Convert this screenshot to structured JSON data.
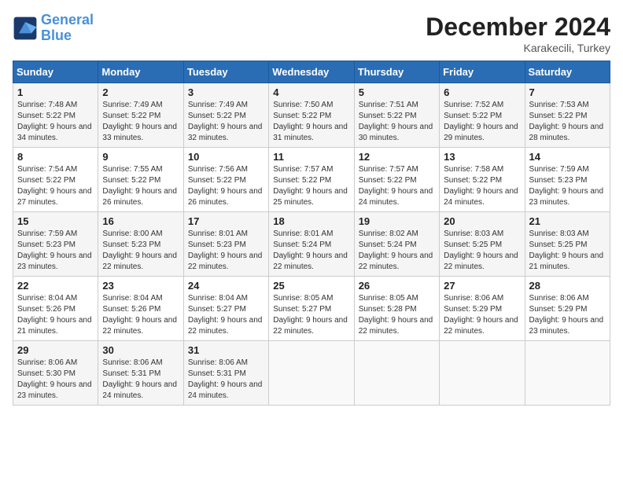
{
  "header": {
    "logo_line1": "General",
    "logo_line2": "Blue",
    "month": "December 2024",
    "location": "Karakecili, Turkey"
  },
  "weekdays": [
    "Sunday",
    "Monday",
    "Tuesday",
    "Wednesday",
    "Thursday",
    "Friday",
    "Saturday"
  ],
  "weeks": [
    [
      {
        "day": "1",
        "sunrise": "Sunrise: 7:48 AM",
        "sunset": "Sunset: 5:22 PM",
        "daylight": "Daylight: 9 hours and 34 minutes."
      },
      {
        "day": "2",
        "sunrise": "Sunrise: 7:49 AM",
        "sunset": "Sunset: 5:22 PM",
        "daylight": "Daylight: 9 hours and 33 minutes."
      },
      {
        "day": "3",
        "sunrise": "Sunrise: 7:49 AM",
        "sunset": "Sunset: 5:22 PM",
        "daylight": "Daylight: 9 hours and 32 minutes."
      },
      {
        "day": "4",
        "sunrise": "Sunrise: 7:50 AM",
        "sunset": "Sunset: 5:22 PM",
        "daylight": "Daylight: 9 hours and 31 minutes."
      },
      {
        "day": "5",
        "sunrise": "Sunrise: 7:51 AM",
        "sunset": "Sunset: 5:22 PM",
        "daylight": "Daylight: 9 hours and 30 minutes."
      },
      {
        "day": "6",
        "sunrise": "Sunrise: 7:52 AM",
        "sunset": "Sunset: 5:22 PM",
        "daylight": "Daylight: 9 hours and 29 minutes."
      },
      {
        "day": "7",
        "sunrise": "Sunrise: 7:53 AM",
        "sunset": "Sunset: 5:22 PM",
        "daylight": "Daylight: 9 hours and 28 minutes."
      }
    ],
    [
      {
        "day": "8",
        "sunrise": "Sunrise: 7:54 AM",
        "sunset": "Sunset: 5:22 PM",
        "daylight": "Daylight: 9 hours and 27 minutes."
      },
      {
        "day": "9",
        "sunrise": "Sunrise: 7:55 AM",
        "sunset": "Sunset: 5:22 PM",
        "daylight": "Daylight: 9 hours and 26 minutes."
      },
      {
        "day": "10",
        "sunrise": "Sunrise: 7:56 AM",
        "sunset": "Sunset: 5:22 PM",
        "daylight": "Daylight: 9 hours and 26 minutes."
      },
      {
        "day": "11",
        "sunrise": "Sunrise: 7:57 AM",
        "sunset": "Sunset: 5:22 PM",
        "daylight": "Daylight: 9 hours and 25 minutes."
      },
      {
        "day": "12",
        "sunrise": "Sunrise: 7:57 AM",
        "sunset": "Sunset: 5:22 PM",
        "daylight": "Daylight: 9 hours and 24 minutes."
      },
      {
        "day": "13",
        "sunrise": "Sunrise: 7:58 AM",
        "sunset": "Sunset: 5:22 PM",
        "daylight": "Daylight: 9 hours and 24 minutes."
      },
      {
        "day": "14",
        "sunrise": "Sunrise: 7:59 AM",
        "sunset": "Sunset: 5:23 PM",
        "daylight": "Daylight: 9 hours and 23 minutes."
      }
    ],
    [
      {
        "day": "15",
        "sunrise": "Sunrise: 7:59 AM",
        "sunset": "Sunset: 5:23 PM",
        "daylight": "Daylight: 9 hours and 23 minutes."
      },
      {
        "day": "16",
        "sunrise": "Sunrise: 8:00 AM",
        "sunset": "Sunset: 5:23 PM",
        "daylight": "Daylight: 9 hours and 22 minutes."
      },
      {
        "day": "17",
        "sunrise": "Sunrise: 8:01 AM",
        "sunset": "Sunset: 5:23 PM",
        "daylight": "Daylight: 9 hours and 22 minutes."
      },
      {
        "day": "18",
        "sunrise": "Sunrise: 8:01 AM",
        "sunset": "Sunset: 5:24 PM",
        "daylight": "Daylight: 9 hours and 22 minutes."
      },
      {
        "day": "19",
        "sunrise": "Sunrise: 8:02 AM",
        "sunset": "Sunset: 5:24 PM",
        "daylight": "Daylight: 9 hours and 22 minutes."
      },
      {
        "day": "20",
        "sunrise": "Sunrise: 8:03 AM",
        "sunset": "Sunset: 5:25 PM",
        "daylight": "Daylight: 9 hours and 22 minutes."
      },
      {
        "day": "21",
        "sunrise": "Sunrise: 8:03 AM",
        "sunset": "Sunset: 5:25 PM",
        "daylight": "Daylight: 9 hours and 21 minutes."
      }
    ],
    [
      {
        "day": "22",
        "sunrise": "Sunrise: 8:04 AM",
        "sunset": "Sunset: 5:26 PM",
        "daylight": "Daylight: 9 hours and 21 minutes."
      },
      {
        "day": "23",
        "sunrise": "Sunrise: 8:04 AM",
        "sunset": "Sunset: 5:26 PM",
        "daylight": "Daylight: 9 hours and 22 minutes."
      },
      {
        "day": "24",
        "sunrise": "Sunrise: 8:04 AM",
        "sunset": "Sunset: 5:27 PM",
        "daylight": "Daylight: 9 hours and 22 minutes."
      },
      {
        "day": "25",
        "sunrise": "Sunrise: 8:05 AM",
        "sunset": "Sunset: 5:27 PM",
        "daylight": "Daylight: 9 hours and 22 minutes."
      },
      {
        "day": "26",
        "sunrise": "Sunrise: 8:05 AM",
        "sunset": "Sunset: 5:28 PM",
        "daylight": "Daylight: 9 hours and 22 minutes."
      },
      {
        "day": "27",
        "sunrise": "Sunrise: 8:06 AM",
        "sunset": "Sunset: 5:29 PM",
        "daylight": "Daylight: 9 hours and 22 minutes."
      },
      {
        "day": "28",
        "sunrise": "Sunrise: 8:06 AM",
        "sunset": "Sunset: 5:29 PM",
        "daylight": "Daylight: 9 hours and 23 minutes."
      }
    ],
    [
      {
        "day": "29",
        "sunrise": "Sunrise: 8:06 AM",
        "sunset": "Sunset: 5:30 PM",
        "daylight": "Daylight: 9 hours and 23 minutes."
      },
      {
        "day": "30",
        "sunrise": "Sunrise: 8:06 AM",
        "sunset": "Sunset: 5:31 PM",
        "daylight": "Daylight: 9 hours and 24 minutes."
      },
      {
        "day": "31",
        "sunrise": "Sunrise: 8:06 AM",
        "sunset": "Sunset: 5:31 PM",
        "daylight": "Daylight: 9 hours and 24 minutes."
      },
      null,
      null,
      null,
      null
    ]
  ]
}
